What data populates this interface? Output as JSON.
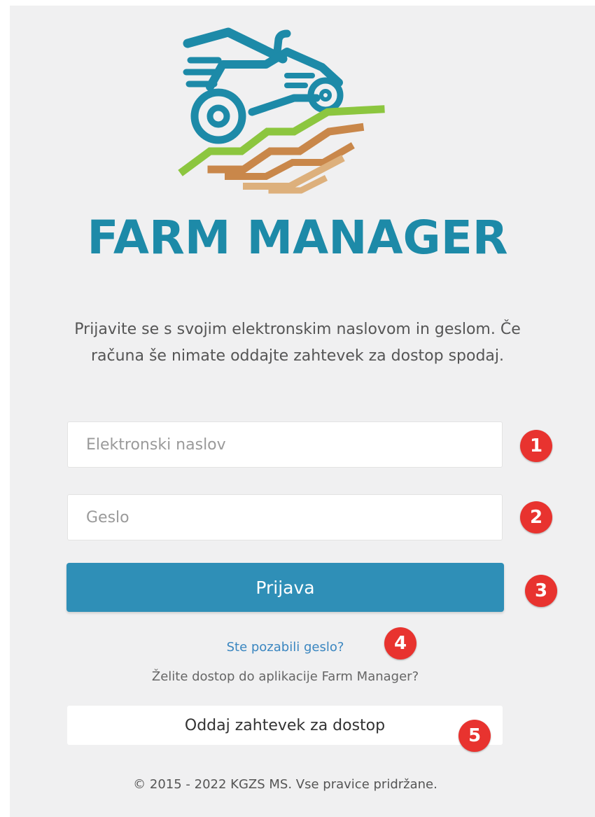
{
  "brand": {
    "name": "FARM MANAGER",
    "colors": {
      "primary": "#1d8aa8",
      "green": "#8cc63f",
      "soil_dark": "#c9874a",
      "soil_light": "#ddb07c"
    }
  },
  "login": {
    "intro": "Prijavite se s svojim elektronskim naslovom in geslom. Če računa še nimate oddajte zahtevek za dostop spodaj.",
    "email_placeholder": "Elektronski naslov",
    "password_placeholder": "Geslo",
    "submit_label": "Prijava",
    "forgot_label": "Ste pozabili geslo?",
    "access_question": "Želite dostop do aplikacije Farm Manager?",
    "request_access_label": "Oddaj zahtevek za dostop",
    "button_color": "#2f8fb7"
  },
  "footer": {
    "copyright": "© 2015 - 2022 KGZS MS. Vse pravice pridržane."
  },
  "annotations": {
    "badges": [
      "1",
      "2",
      "3",
      "4",
      "5"
    ],
    "badge_color": "#e8332f"
  }
}
